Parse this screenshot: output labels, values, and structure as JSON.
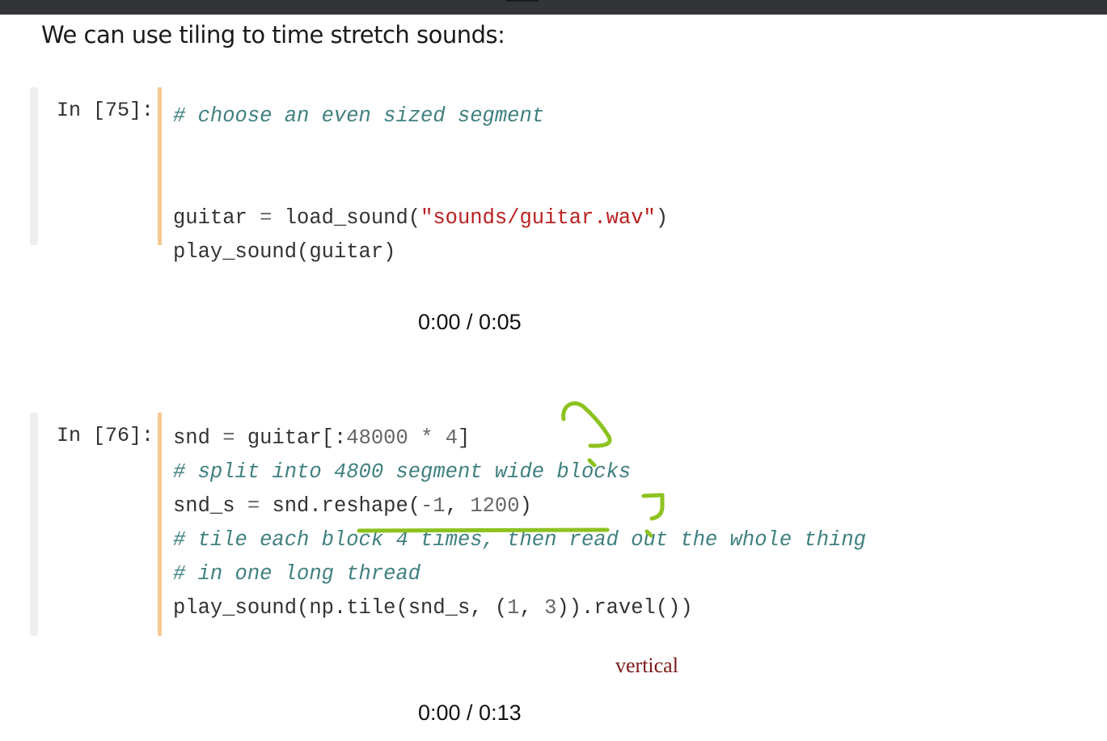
{
  "markdown": {
    "heading": "We can use tiling to time stretch sounds:"
  },
  "cells": [
    {
      "prompt": "In [75]:",
      "lines": [
        [
          {
            "t": "# choose an even sized segment",
            "c": "cm-comment"
          }
        ],
        [],
        [
          {
            "t": "guitar "
          },
          {
            "t": "=",
            "c": "cm-op"
          },
          {
            "t": " load_sound("
          },
          {
            "t": "\"sounds/guitar.wav\"",
            "c": "cm-string"
          },
          {
            "t": ")"
          }
        ],
        [
          {
            "t": "play_sound(guitar)"
          }
        ]
      ],
      "audio_time": "0:00 / 0:05"
    },
    {
      "prompt": "In [76]:",
      "lines": [
        [
          {
            "t": "snd "
          },
          {
            "t": "=",
            "c": "cm-op"
          },
          {
            "t": " guitar[:"
          },
          {
            "t": "48000",
            "c": "cm-number"
          },
          {
            "t": " "
          },
          {
            "t": "*",
            "c": "cm-op"
          },
          {
            "t": " "
          },
          {
            "t": "4",
            "c": "cm-number"
          },
          {
            "t": "]"
          }
        ],
        [
          {
            "t": "# split into 4800 segment wide blocks",
            "c": "cm-comment"
          }
        ],
        [
          {
            "t": "snd_s "
          },
          {
            "t": "=",
            "c": "cm-op"
          },
          {
            "t": " snd.reshape("
          },
          {
            "t": "-",
            "c": "cm-op"
          },
          {
            "t": "1",
            "c": "cm-number"
          },
          {
            "t": ", "
          },
          {
            "t": "1200",
            "c": "cm-number"
          },
          {
            "t": ")"
          }
        ],
        [
          {
            "t": "# tile each block 4 times, then read out the whole thing",
            "c": "cm-comment"
          }
        ],
        [
          {
            "t": "# in one long thread",
            "c": "cm-comment"
          }
        ],
        [
          {
            "t": "play_sound(np.tile(snd_s, ("
          },
          {
            "t": "1",
            "c": "cm-number"
          },
          {
            "t": ", "
          },
          {
            "t": "3",
            "c": "cm-number"
          },
          {
            "t": ")).ravel())"
          }
        ]
      ],
      "audio_time": "0:00 / 0:13"
    }
  ],
  "annotations": {
    "note": "vertical",
    "ink_color": "#8dc21f"
  }
}
